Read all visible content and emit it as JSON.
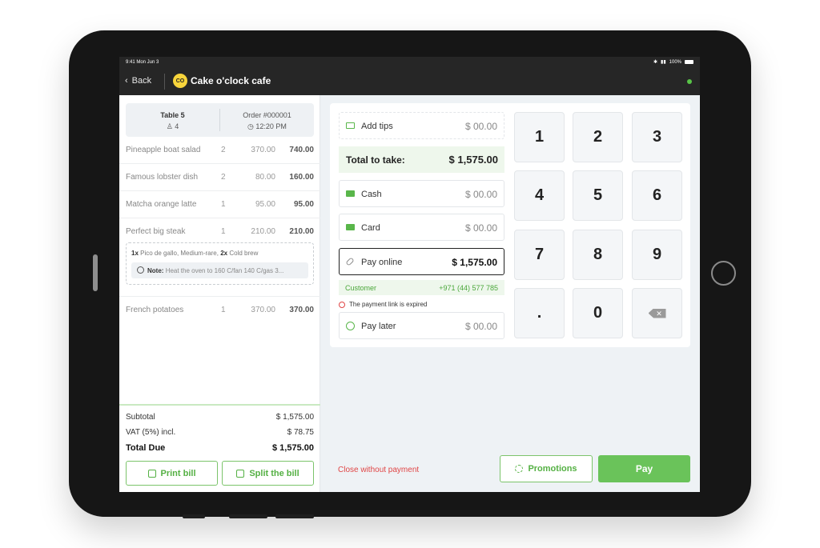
{
  "status": {
    "time": "9:41 Mon Jun 3",
    "battery": "100%"
  },
  "nav": {
    "back_label": "Back",
    "logo_text": "CO",
    "cafe_name": "Cake o'clock cafe"
  },
  "order": {
    "table_label": "Table 5",
    "guests": "4",
    "order_number": "Order #000001",
    "time": "12:20 PM"
  },
  "items": [
    {
      "name": "Pineapple boat salad",
      "qty": "2",
      "price": "370.00",
      "total": "740.00"
    },
    {
      "name": "Famous lobster dish",
      "qty": "2",
      "price": "80.00",
      "total": "160.00"
    },
    {
      "name": "Matcha orange latte",
      "qty": "1",
      "price": "95.00",
      "total": "95.00"
    },
    {
      "name": "Perfect big steak",
      "qty": "1",
      "price": "210.00",
      "total": "210.00"
    },
    {
      "name": "French potatoes",
      "qty": "1",
      "price": "370.00",
      "total": "370.00"
    }
  ],
  "modifiers": {
    "qty1": "1x",
    "text1": "Pico de gallo, Medium-rare,",
    "qty2": "2x",
    "text2": "Cold brew",
    "note_label": "Note:",
    "note_text": "Heat the oven to 160 C/fan 140 C/gas 3..."
  },
  "totals": {
    "subtotal_label": "Subtotal",
    "subtotal": "$ 1,575.00",
    "vat_label": "VAT (5%) incl.",
    "vat": "$ 78.75",
    "due_label": "Total Due",
    "due": "$ 1,575.00"
  },
  "left_buttons": {
    "print": "Print bill",
    "split": "Split the bill"
  },
  "payment": {
    "tips_label": "Add tips",
    "tips_amount": "$ 00.00",
    "total_take_label": "Total to take:",
    "total_take": "$ 1,575.00",
    "cash_label": "Cash",
    "cash_amount": "$ 00.00",
    "card_label": "Card",
    "card_amount": "$ 00.00",
    "online_label": "Pay online",
    "online_amount": "$ 1,575.00",
    "customer_label": "Customer",
    "customer_phone": "+971 (44) 577 785",
    "expired_text": "The payment link is expired",
    "later_label": "Pay later",
    "later_amount": "$ 00.00"
  },
  "keypad": [
    "1",
    "2",
    "3",
    "4",
    "5",
    "6",
    "7",
    "8",
    "9",
    ".",
    "0"
  ],
  "footer": {
    "close_label": "Close without payment",
    "promotions_label": "Promotions",
    "pay_label": "Pay"
  },
  "colors": {
    "accent": "#6ac35a",
    "danger": "#e04646",
    "dark": "#262626"
  }
}
